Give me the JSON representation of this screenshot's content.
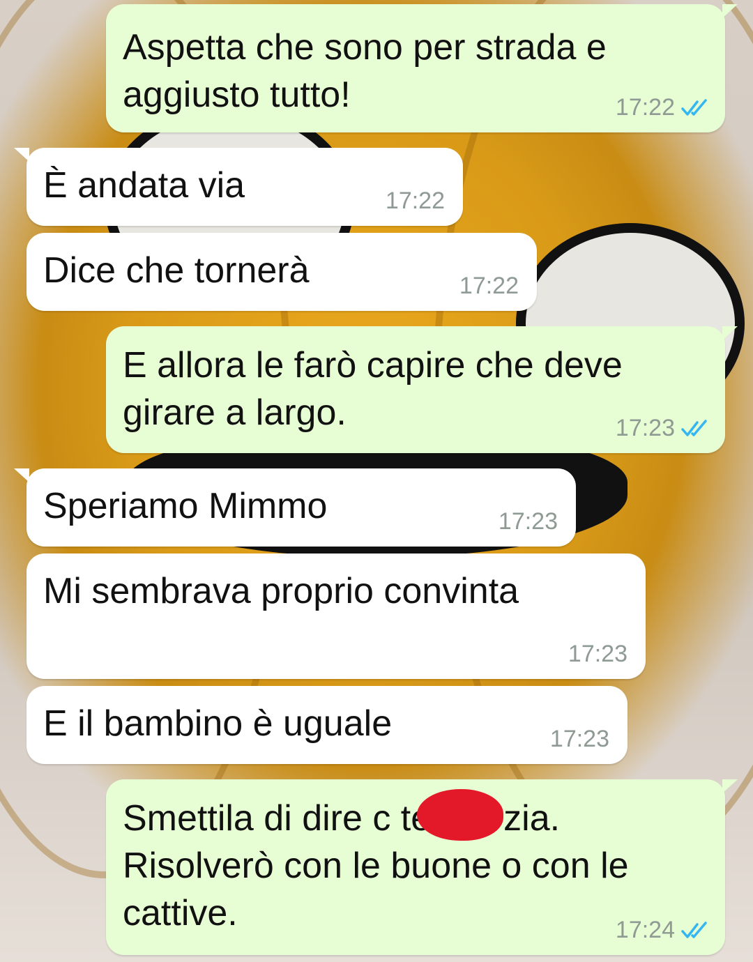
{
  "chat": {
    "messages": [
      {
        "direction": "outgoing",
        "text": "Aspetta che sono per strada e\naggiusto tutto!",
        "time": "17:22",
        "status_icon": "double-check-blue-icon"
      },
      {
        "direction": "incoming",
        "text": "È andata via",
        "time": "17:22"
      },
      {
        "direction": "incoming",
        "text": "Dice che tornerà",
        "time": "17:22"
      },
      {
        "direction": "outgoing",
        "text": "E allora le farò capire che deve\ngirare a largo.",
        "time": "17:23",
        "status_icon": "double-check-blue-icon"
      },
      {
        "direction": "incoming",
        "text": "Speriamo Mimmo",
        "time": "17:23"
      },
      {
        "direction": "incoming",
        "text": "Mi sembrava proprio convinta",
        "time": "17:23"
      },
      {
        "direction": "incoming",
        "text": "E il bambino è uguale",
        "time": "17:23"
      },
      {
        "direction": "outgoing",
        "text": "Smettila di dire c          te Marzia.\nRisolverò con le buone o con le\ncattive.",
        "time": "17:24",
        "status_icon": "double-check-blue-icon"
      }
    ]
  },
  "colors": {
    "outgoing_bubble": "#e7fdd4",
    "incoming_bubble": "#ffffff",
    "read_ticks": "#34b7f1",
    "timestamp": "#8e9a93",
    "redaction": "#e3192a"
  }
}
